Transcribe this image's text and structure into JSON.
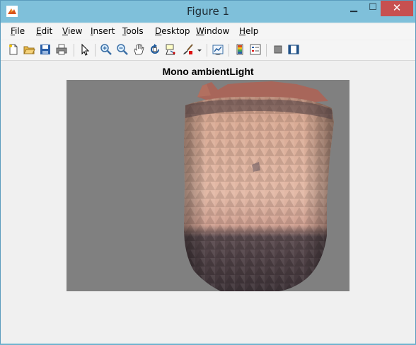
{
  "window": {
    "title": "Figure 1",
    "minimize_glyph": "▁",
    "maximize_glyph": "☐",
    "close_glyph": "✕",
    "app_icon": "matlab-icon"
  },
  "menu": [
    {
      "label": "File",
      "key": "F",
      "rest": "ile"
    },
    {
      "label": "Edit",
      "key": "E",
      "rest": "dit"
    },
    {
      "label": "View",
      "key": "V",
      "rest": "iew"
    },
    {
      "label": "Insert",
      "key": "I",
      "rest": "nsert"
    },
    {
      "label": "Tools",
      "key": "T",
      "rest": "ools"
    },
    {
      "label": "Desktop",
      "key": "D",
      "rest": "esktop"
    },
    {
      "label": "Window",
      "key": "W",
      "rest": "indow"
    },
    {
      "label": "Help",
      "key": "H",
      "rest": "elp"
    }
  ],
  "toolbar": {
    "icons": [
      "new-figure-icon",
      "open-file-icon",
      "save-icon",
      "print-icon",
      "edit-plot-arrow-icon",
      "zoom-in-icon",
      "zoom-out-icon",
      "pan-hand-icon",
      "rotate-3d-icon",
      "data-cursor-icon",
      "brush-icon",
      "brush-dropdown-icon",
      "link-plot-icon",
      "insert-colorbar-icon",
      "insert-legend-icon",
      "hide-plot-tools-icon",
      "show-plot-tools-icon"
    ]
  },
  "axes": {
    "title": "Mono ambientLight",
    "background": "#808080"
  },
  "colors": {
    "titlebar": "#7fc0da",
    "close_button": "#c75050",
    "figure_background": "#f0f0f0"
  }
}
